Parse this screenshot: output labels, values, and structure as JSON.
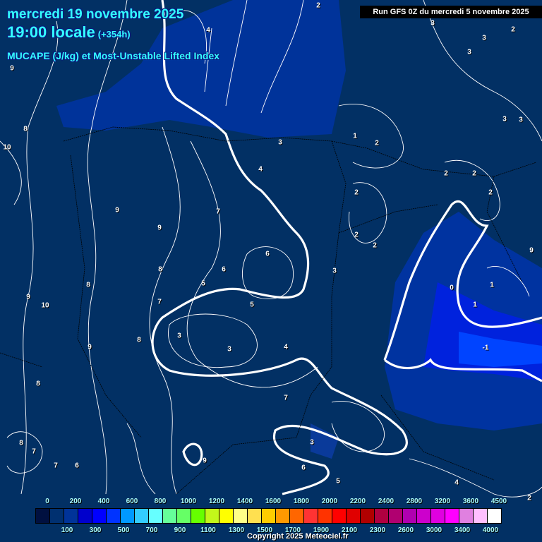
{
  "header": {
    "date": "mercredi 19 novembre 2025",
    "time": "19:00 locale",
    "lead": "(+354h)",
    "parameter": "MUCAPE (J/kg) et Most-Unstable Lifted Index",
    "run": "Run GFS 0Z du mercredi 5 novembre 2025"
  },
  "legend": {
    "colors": [
      "#001040",
      "#003070",
      "#003399",
      "#0000cc",
      "#0000ff",
      "#0033ff",
      "#0099ff",
      "#33ccff",
      "#66ffff",
      "#66ff99",
      "#66ff66",
      "#66ff00",
      "#c3f71a",
      "#ffff00",
      "#ffff88",
      "#ffe050",
      "#ffcc00",
      "#ff9900",
      "#ff6600",
      "#ff3333",
      "#ff3300",
      "#ff0000",
      "#e00000",
      "#b00000",
      "#b00040",
      "#b00070",
      "#b000b0",
      "#cc00cc",
      "#e000e0",
      "#ff00ff",
      "#e080e0",
      "#ffc0ff",
      "#ffffff"
    ],
    "top_labels": [
      "0",
      "200",
      "400",
      "600",
      "800",
      "1000",
      "1200",
      "1400",
      "1600",
      "1800",
      "2000",
      "2200",
      "2400",
      "2800",
      "3200",
      "3600",
      "4500"
    ],
    "bottom_labels": [
      "100",
      "300",
      "500",
      "700",
      "900",
      "1100",
      "1300",
      "1500",
      "1700",
      "1900",
      "2100",
      "2300",
      "2600",
      "3000",
      "3400",
      "4000"
    ]
  },
  "contour_labels": [
    "2",
    "4",
    "3",
    "2",
    "3",
    "3",
    "9",
    "8",
    "10",
    "9",
    "9",
    "7",
    "4",
    "3",
    "1",
    "2",
    "2",
    "2",
    "2",
    "2",
    "2",
    "9",
    "6",
    "6",
    "5",
    "7",
    "5",
    "3",
    "4",
    "3",
    "0",
    "1",
    "1",
    "-1",
    "3",
    "2",
    "3",
    "3",
    "8",
    "9",
    "10",
    "8",
    "9",
    "8",
    "8",
    "7",
    "6",
    "7",
    "7",
    "9",
    "3",
    "6",
    "5",
    "8",
    "4",
    "2"
  ],
  "copyright": "Copyright 2025 Meteociel.fr"
}
